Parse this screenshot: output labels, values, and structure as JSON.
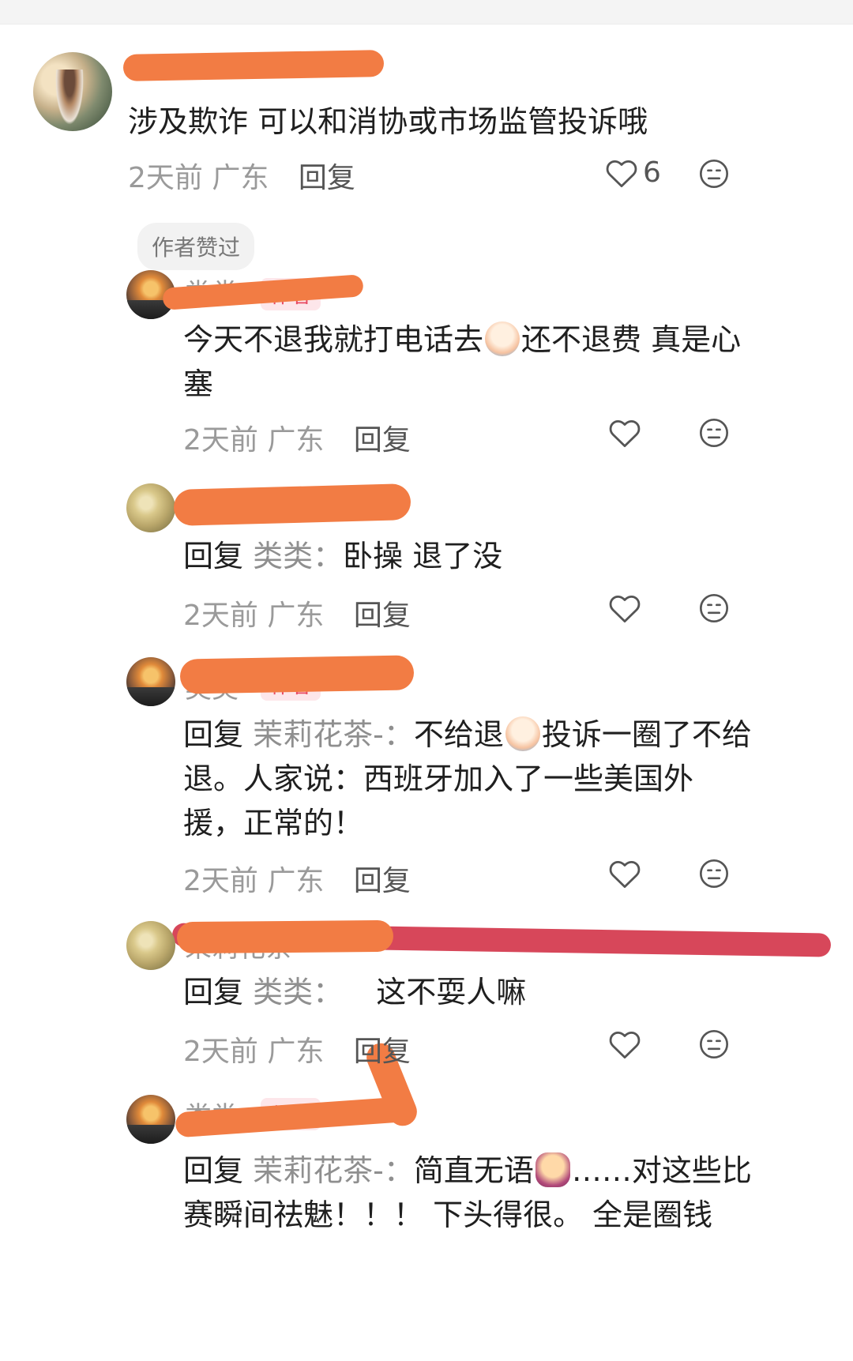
{
  "comments": [
    {
      "username": "",
      "text": "涉及欺诈 可以和消协或市场监管投诉哦",
      "time": "2天前",
      "location": "广东",
      "reply_label": "回复",
      "likes": "6",
      "author_liked_label": "作者赞过"
    },
    {
      "username": "类类",
      "author_tag": "作者",
      "text_before_emoji": "今天不退我就打电话去",
      "text_after_emoji": "还不退费 真是心塞",
      "time": "2天前",
      "location": "广东",
      "reply_label": "回复"
    },
    {
      "username": "",
      "reply_prefix": "回复",
      "reply_target": "类类",
      "text": "卧操 退了没",
      "time": "2天前",
      "location": "广东",
      "reply_label": "回复"
    },
    {
      "username": "类类",
      "author_tag": "作者",
      "reply_prefix": "回复",
      "reply_target": "茉莉花茶-",
      "text_before_emoji": "不给退",
      "text_after_emoji": "投诉一圈了不给退。人家说：西班牙加入了一些美国外援，正常的！",
      "time": "2天前",
      "location": "广东",
      "reply_label": "回复"
    },
    {
      "username": "茉莉花茶",
      "reply_prefix": "回复",
      "reply_target": "类类",
      "text": "这不耍人嘛",
      "time": "2天前",
      "location": "广东",
      "reply_label": "回复"
    },
    {
      "username": "类类",
      "author_tag": "作者",
      "reply_prefix": "回复",
      "reply_target": "茉莉花茶-",
      "text_before_emoji": "简直无语",
      "text_after_emoji": "……对这些比赛瞬间祛魅！！！ 下头得很。 全是圈钱"
    }
  ],
  "icons": {
    "like": "heart-icon",
    "dislike": "meh-face-icon"
  },
  "colors": {
    "redaction": "#f27c44",
    "strike_line": "#d7475a",
    "author_tag_text": "#e84a62",
    "author_tag_bg": "#fde6ea"
  }
}
